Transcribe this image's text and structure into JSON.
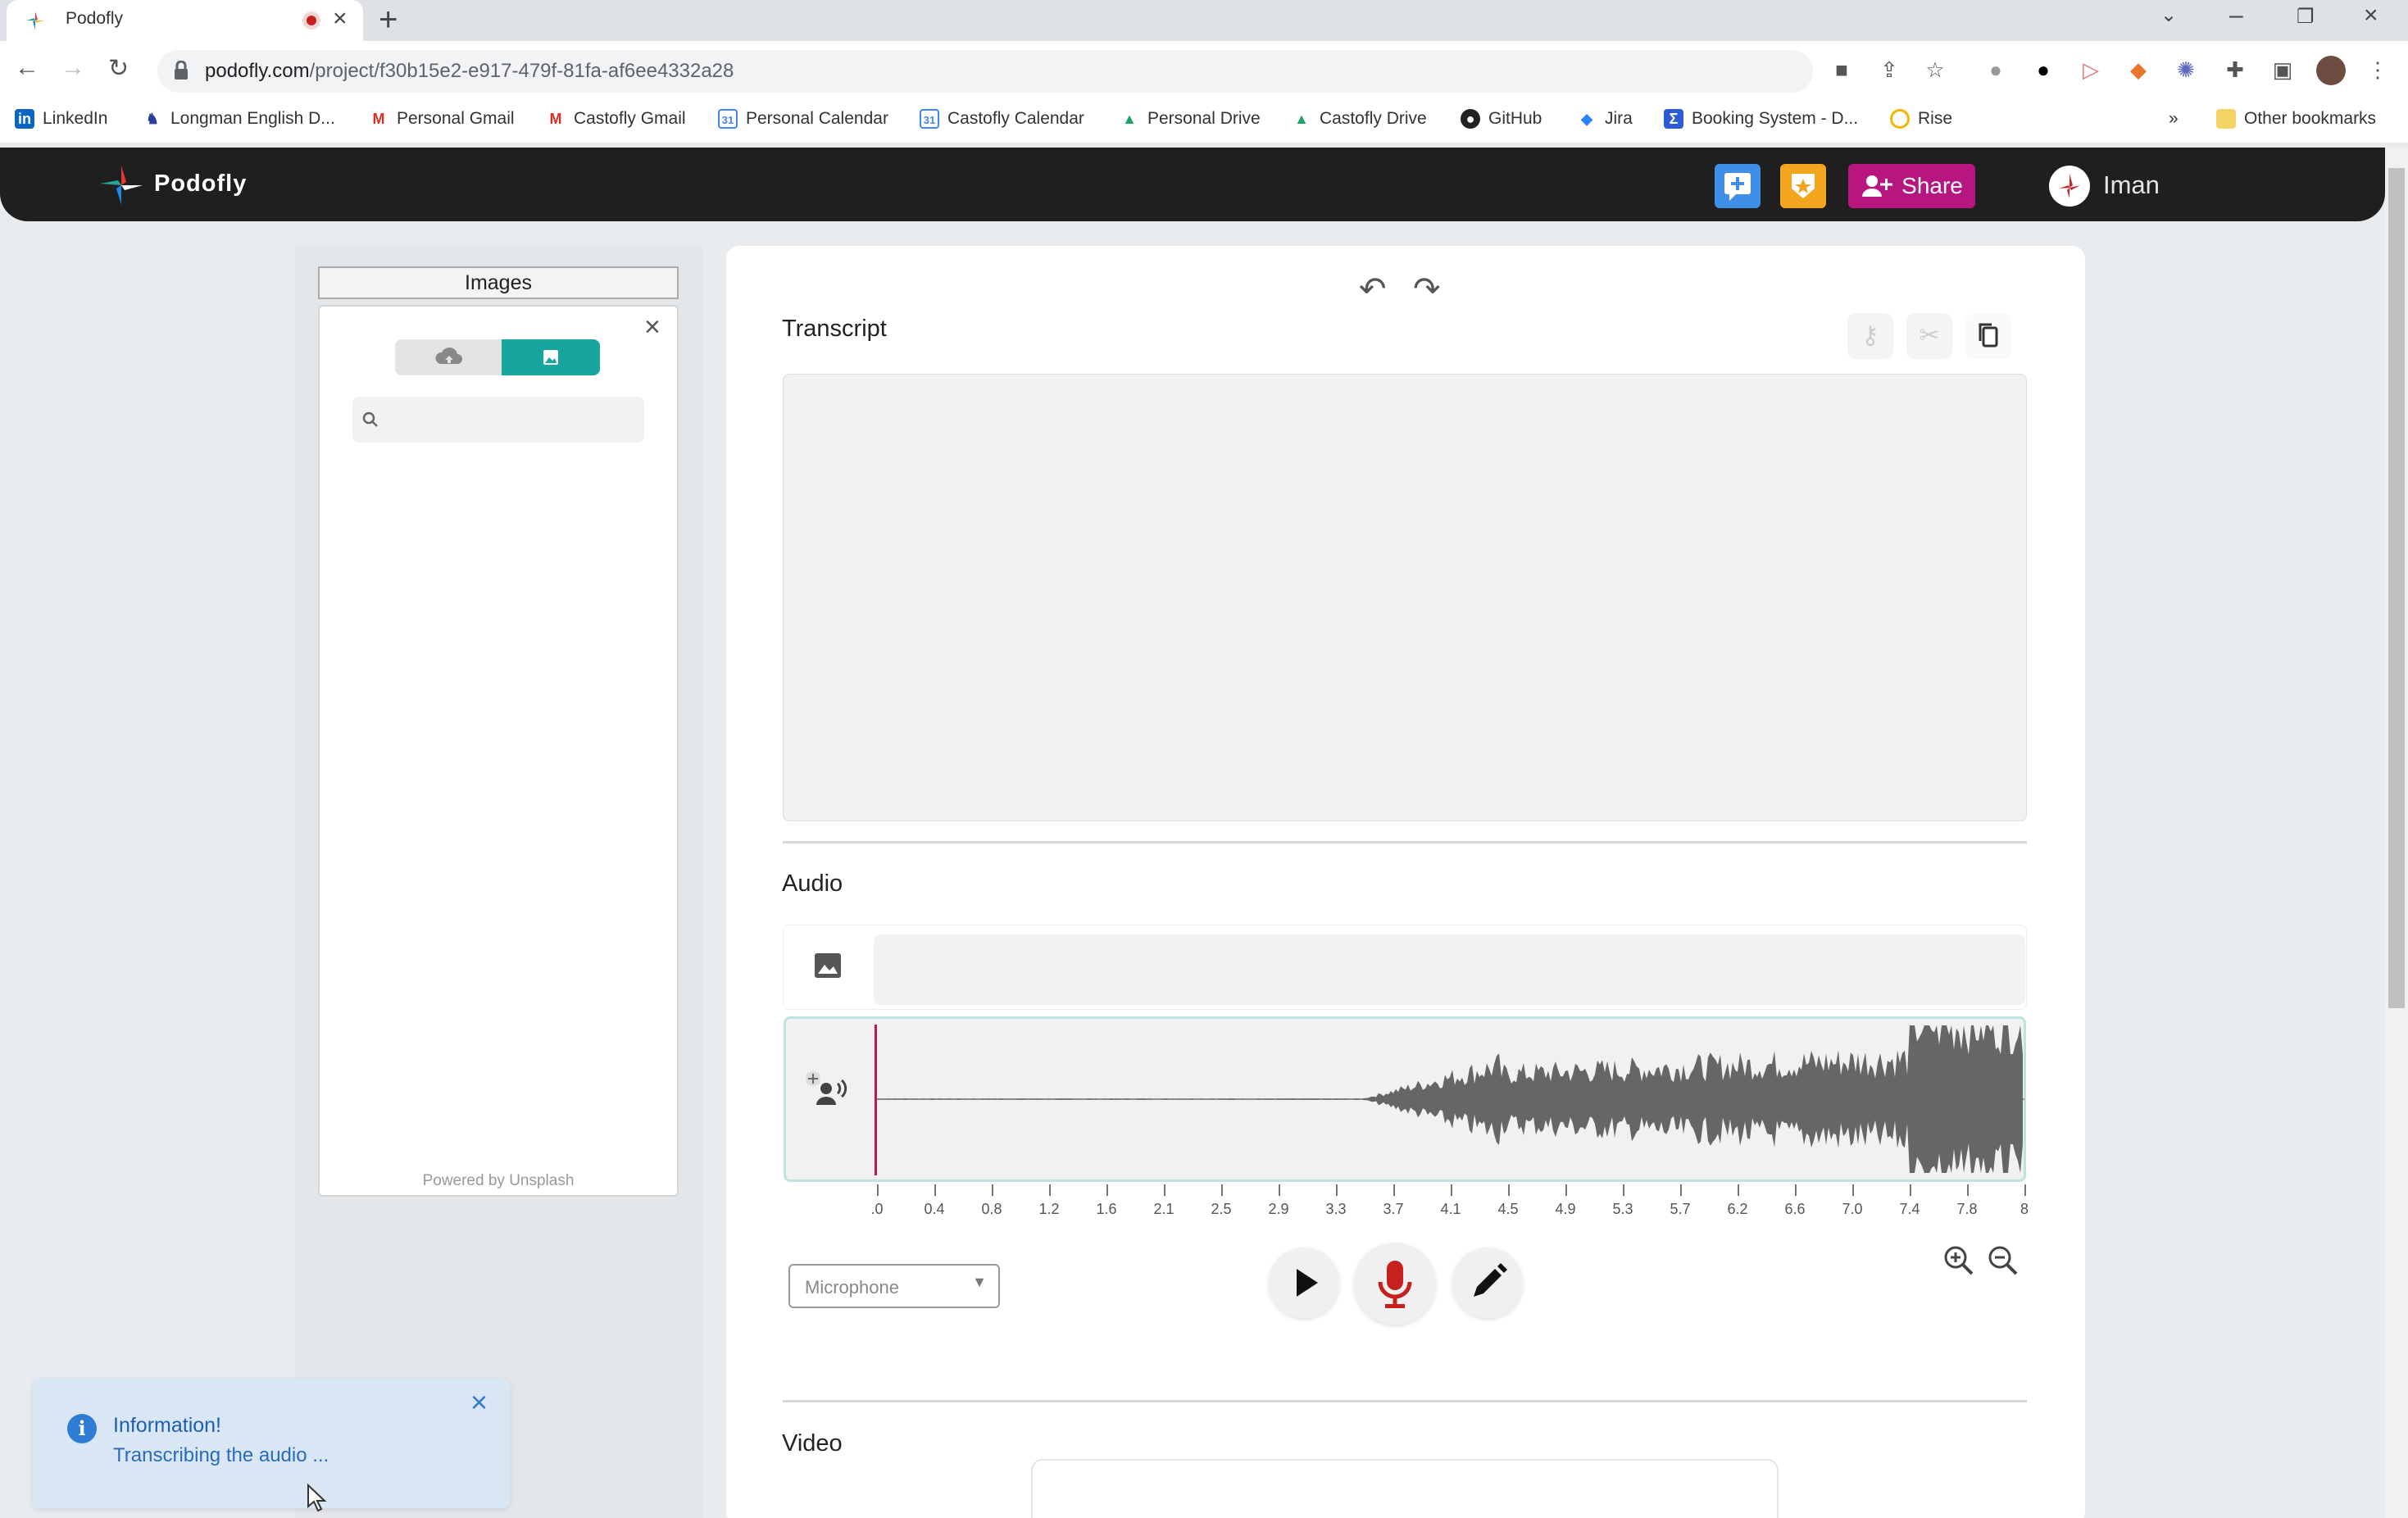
{
  "browser": {
    "tab_title": "Podofly",
    "url_host": "podofly.com",
    "url_path": "/project/f30b15e2-e917-479f-81fa-af6ee4332a28",
    "bookmarks": [
      {
        "label": "LinkedIn"
      },
      {
        "label": "Longman English D..."
      },
      {
        "label": "Personal Gmail"
      },
      {
        "label": "Castofly Gmail"
      },
      {
        "label": "Personal Calendar"
      },
      {
        "label": "Castofly Calendar"
      },
      {
        "label": "Personal Drive"
      },
      {
        "label": "Castofly Drive"
      },
      {
        "label": "GitHub"
      },
      {
        "label": "Jira"
      },
      {
        "label": "Booking System - D..."
      },
      {
        "label": "Rise"
      }
    ],
    "more_bookmarks": "»",
    "other_bookmarks": "Other bookmarks"
  },
  "app": {
    "brand": "Podofly",
    "share_label": "Share",
    "user_name": "Iman",
    "colors": {
      "accent": "#17a5a0",
      "share": "#b7157f",
      "chat": "#3f8ee8",
      "badge": "#f4a51f",
      "record": "#c5221f"
    }
  },
  "images_panel": {
    "tab_label": "Images",
    "search_placeholder": "",
    "powered_by": "Powered by Unsplash"
  },
  "editor": {
    "transcript_title": "Transcript",
    "audio_title": "Audio",
    "video_title": "Video",
    "microphone_select": "Microphone",
    "timeline_labels": [
      ".0",
      "0.4",
      "0.8",
      "1.2",
      "1.6",
      "2.1",
      "2.5",
      "2.9",
      "3.3",
      "3.7",
      "4.1",
      "4.5",
      "4.9",
      "5.3",
      "5.7",
      "6.2",
      "6.6",
      "7.0",
      "7.4",
      "7.8",
      "8"
    ]
  },
  "toast": {
    "title": "Information!",
    "message": "Transcribing the audio ..."
  }
}
